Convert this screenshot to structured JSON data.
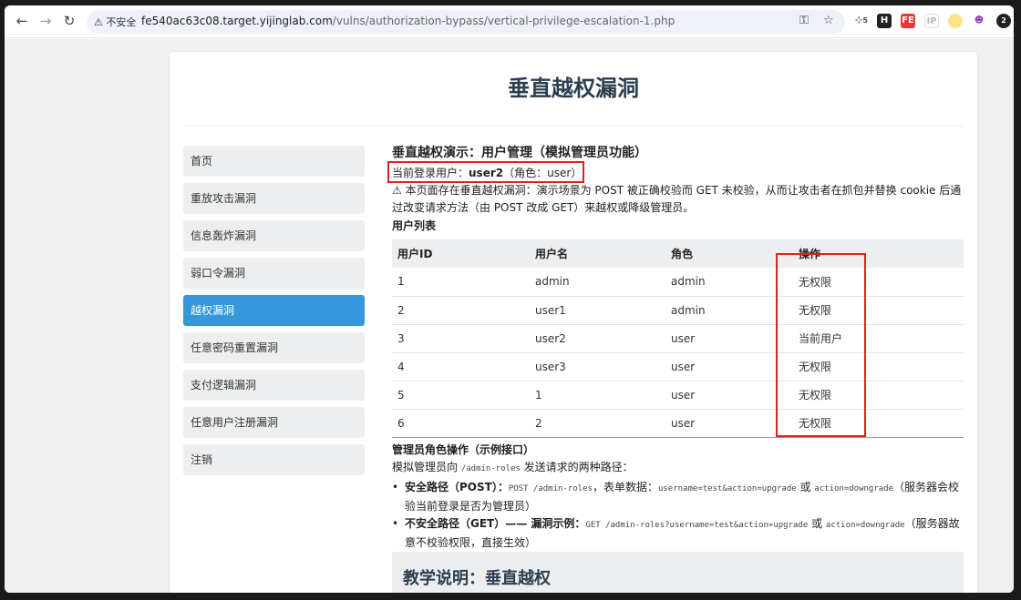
{
  "browser": {
    "insecure_label": "不安全",
    "url_host": "fe540ac63c08.target.yijinglab.com",
    "url_path": "/vulns/authorization-bypass/vertical-privilege-escalation-1.php",
    "ext_badge": "5",
    "ext_badge2": "2"
  },
  "page": {
    "title": "垂直越权漏洞",
    "sidebar": [
      {
        "label": "首页"
      },
      {
        "label": "重放攻击漏洞"
      },
      {
        "label": "信息轰炸漏洞"
      },
      {
        "label": "弱口令漏洞"
      },
      {
        "label": "越权漏洞",
        "active": true
      },
      {
        "label": "任意密码重置漏洞"
      },
      {
        "label": "支付逻辑漏洞"
      },
      {
        "label": "任意用户注册漏洞"
      },
      {
        "label": "注销"
      }
    ],
    "section_title": "垂直越权演示：用户管理（模拟管理员功能）",
    "current_user_prefix": "当前登录用户：",
    "current_user_name": "user2",
    "current_user_role": "（角色：user）",
    "warning": "⚠ 本页面存在垂直越权漏洞：演示场景为 POST 被正确校验而 GET 未校验，从而让攻击者在抓包并替换 cookie 后通过改变请求方法（由 POST 改成 GET）来越权或降级管理员。",
    "user_list_title": "用户列表",
    "table": {
      "headers": [
        "用户ID",
        "用户名",
        "角色",
        "操作"
      ],
      "rows": [
        [
          "1",
          "admin",
          "admin",
          "无权限"
        ],
        [
          "2",
          "user1",
          "admin",
          "无权限"
        ],
        [
          "3",
          "user2",
          "user",
          "当前用户"
        ],
        [
          "4",
          "user3",
          "user",
          "无权限"
        ],
        [
          "5",
          "1",
          "user",
          "无权限"
        ],
        [
          "6",
          "2",
          "user",
          "无权限"
        ]
      ]
    },
    "admin_ops_title": "管理员角色操作（示例接口）",
    "admin_ops_desc_a": "模拟管理员向 ",
    "admin_ops_desc_code": "/admin-roles",
    "admin_ops_desc_b": " 发送请求的两种路径：",
    "safe_label": "安全路径（POST）：",
    "safe_code1": "POST /admin-roles",
    "safe_text1": "，表单数据：",
    "safe_code2": "username=test&action=upgrade",
    "safe_text2": " 或 ",
    "safe_code3": "action=downgrade",
    "safe_text3": "（服务器会校验当前登录是否为管理员）",
    "unsafe_label": "不安全路径（GET）—— 漏洞示例：",
    "unsafe_code1": "GET /admin-roles?username=test&action=upgrade",
    "unsafe_text1": " 或 ",
    "unsafe_code2": "action=downgrade",
    "unsafe_text2": "（服务器故意不校验权限，直接生效）",
    "teach_title": "教学说明：垂直越权"
  }
}
